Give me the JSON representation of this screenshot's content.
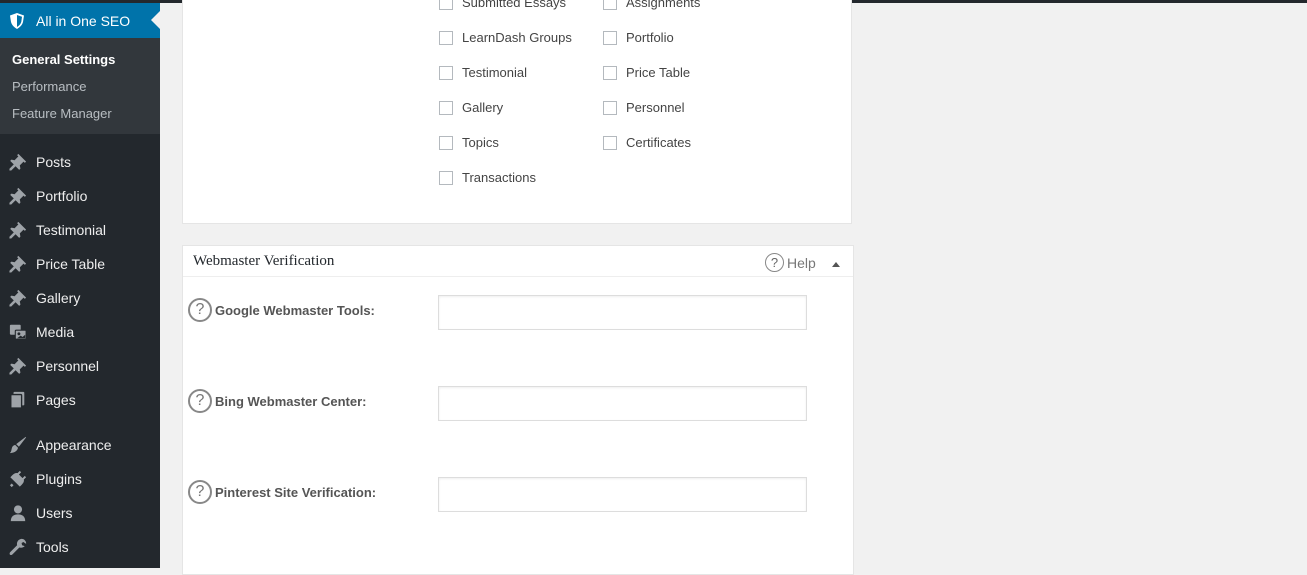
{
  "sidebar": {
    "current_menu": {
      "label": "All in One SEO",
      "icon": "shield-icon"
    },
    "submenu": [
      {
        "label": "General Settings",
        "active": true
      },
      {
        "label": "Performance",
        "active": false
      },
      {
        "label": "Feature Manager",
        "active": false
      }
    ],
    "menu_group_1": [
      {
        "label": "Posts",
        "icon": "pin-icon"
      },
      {
        "label": "Portfolio",
        "icon": "pin-icon"
      },
      {
        "label": "Testimonial",
        "icon": "pin-icon"
      },
      {
        "label": "Price Table",
        "icon": "pin-icon"
      },
      {
        "label": "Gallery",
        "icon": "pin-icon"
      },
      {
        "label": "Media",
        "icon": "media-icon"
      },
      {
        "label": "Personnel",
        "icon": "pin-icon"
      },
      {
        "label": "Pages",
        "icon": "pages-icon"
      }
    ],
    "menu_group_2": [
      {
        "label": "Appearance",
        "icon": "brush-icon"
      },
      {
        "label": "Plugins",
        "icon": "plugin-icon"
      },
      {
        "label": "Users",
        "icon": "user-icon"
      },
      {
        "label": "Tools",
        "icon": "wrench-icon"
      }
    ]
  },
  "post_types": {
    "col1": [
      {
        "label": "Submitted Essays",
        "checked": false
      },
      {
        "label": "LearnDash Groups",
        "checked": false
      },
      {
        "label": "Testimonial",
        "checked": false
      },
      {
        "label": "Gallery",
        "checked": false
      },
      {
        "label": "Topics",
        "checked": false
      },
      {
        "label": "Transactions",
        "checked": false
      }
    ],
    "col2": [
      {
        "label": "Assignments",
        "checked": false
      },
      {
        "label": "Portfolio",
        "checked": false
      },
      {
        "label": "Price Table",
        "checked": false
      },
      {
        "label": "Personnel",
        "checked": false
      },
      {
        "label": "Certificates",
        "checked": false
      }
    ]
  },
  "webmaster": {
    "title": "Webmaster Verification",
    "help_label": "Help",
    "help_glyph": "?",
    "fields": [
      {
        "label": "Google Webmaster Tools:",
        "value": ""
      },
      {
        "label": "Bing Webmaster Center:",
        "value": ""
      },
      {
        "label": "Pinterest Site Verification:",
        "value": ""
      }
    ]
  },
  "colors": {
    "sidebar_bg": "#23282d",
    "submenu_bg": "#32373c",
    "accent": "#0073aa",
    "page_bg": "#f1f1f1"
  }
}
